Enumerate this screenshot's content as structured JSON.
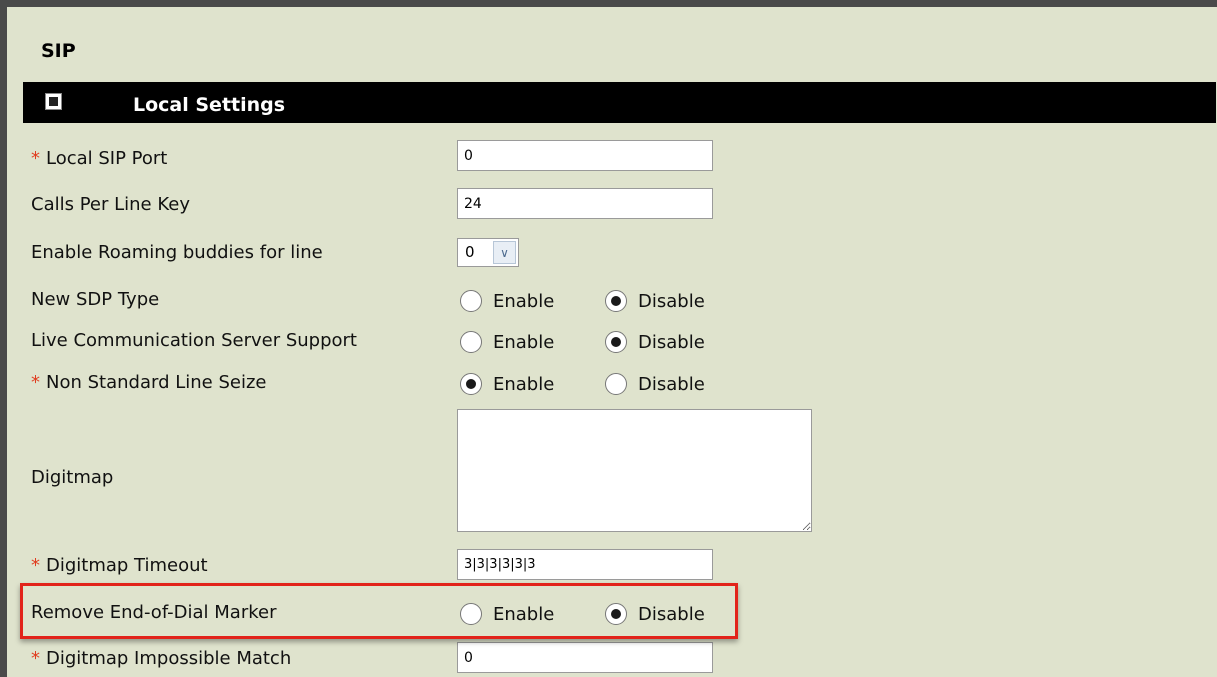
{
  "section": {
    "title": "SIP",
    "bar_title": "Local Settings"
  },
  "required_marker": "*",
  "rows": {
    "local_sip_port": {
      "label": "Local SIP Port",
      "value": "0"
    },
    "calls_per_line_key": {
      "label": "Calls Per Line Key",
      "value": "24"
    },
    "roaming_buddies": {
      "label": "Enable Roaming buddies for line",
      "selected": "0"
    },
    "new_sdp_type": {
      "label": "New SDP Type",
      "selected": "Disable"
    },
    "lcs_support": {
      "label": "Live Communication Server Support",
      "selected": "Disable"
    },
    "non_standard_line_seize": {
      "label": "Non Standard Line Seize",
      "selected": "Enable"
    },
    "digitmap": {
      "label": "Digitmap",
      "value": ""
    },
    "digitmap_timeout": {
      "label": "Digitmap Timeout",
      "value": "3|3|3|3|3|3"
    },
    "remove_end_of_dial_marker": {
      "label": "Remove End-of-Dial Marker",
      "selected": "Disable"
    },
    "digitmap_impossible_match": {
      "label": "Digitmap Impossible Match",
      "value": "0"
    }
  },
  "radio_options": {
    "enable": "Enable",
    "disable": "Disable"
  },
  "icons": {
    "collapse": "collapse-minus-icon",
    "dropdown": "chevron-down-icon"
  },
  "colors": {
    "background": "#dfe3cd",
    "bar": "#000000",
    "required": "#e03c1f",
    "highlight": "#e2231a"
  }
}
